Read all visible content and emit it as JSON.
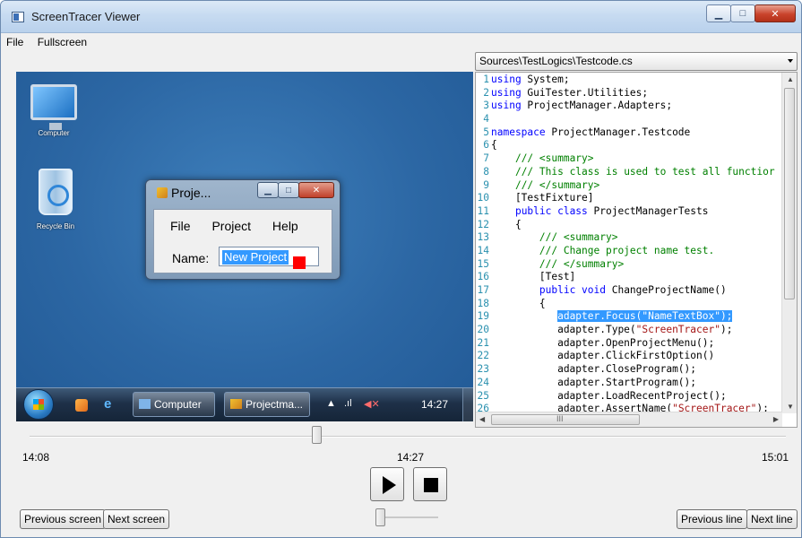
{
  "window": {
    "title": "ScreenTracer Viewer",
    "controls": {
      "minimize": "▁",
      "maximize": "□",
      "close": "✕"
    }
  },
  "menubar": {
    "items": [
      "File",
      "Fullscreen"
    ]
  },
  "capture": {
    "desktop_icons": [
      {
        "name": "computer-icon",
        "label": "Computer"
      },
      {
        "name": "recycle-bin-icon",
        "label": "Recycle Bin"
      }
    ],
    "app_window": {
      "title": "Proje...",
      "menu": [
        "File",
        "Project",
        "Help"
      ],
      "name_label": "Name:",
      "name_value": "New Project",
      "marker_color": "#ff0000"
    },
    "taskbar": {
      "buttons": [
        "Computer",
        "Projectma..."
      ],
      "clock": "14:27"
    }
  },
  "code_panel": {
    "file_path": "Sources\\TestLogics\\Testcode.cs",
    "highlight_line": 19,
    "lines": [
      {
        "n": "1",
        "parts": [
          [
            "kw",
            "using"
          ],
          [
            "",
            "System;"
          ]
        ]
      },
      {
        "n": "2",
        "parts": [
          [
            "kw",
            "using"
          ],
          [
            "",
            "GuiTester.Utilities;"
          ]
        ]
      },
      {
        "n": "3",
        "parts": [
          [
            "kw",
            "using"
          ],
          [
            "",
            "ProjectManager.Adapters;"
          ]
        ]
      },
      {
        "n": "4",
        "parts": []
      },
      {
        "n": "5",
        "parts": [
          [
            "kw",
            "namespace"
          ],
          [
            "",
            "ProjectManager.Testcode"
          ]
        ]
      },
      {
        "n": "6",
        "parts": [
          [
            "",
            "{"
          ]
        ]
      },
      {
        "n": "7",
        "parts": [
          [
            "",
            "    "
          ],
          [
            "cm",
            "/// <summary>"
          ]
        ]
      },
      {
        "n": "8",
        "parts": [
          [
            "",
            "    "
          ],
          [
            "cm",
            "/// This class is used to test all functior"
          ]
        ]
      },
      {
        "n": "9",
        "parts": [
          [
            "",
            "    "
          ],
          [
            "cm",
            "/// </summary>"
          ]
        ]
      },
      {
        "n": "10",
        "parts": [
          [
            "",
            "    [TestFixture]"
          ]
        ]
      },
      {
        "n": "11",
        "parts": [
          [
            "",
            "    "
          ],
          [
            "kw",
            "public class"
          ],
          [
            "",
            "ProjectManagerTests"
          ]
        ]
      },
      {
        "n": "12",
        "parts": [
          [
            "",
            "    {"
          ]
        ]
      },
      {
        "n": "13",
        "parts": [
          [
            "",
            "        "
          ],
          [
            "cm",
            "/// <summary>"
          ]
        ]
      },
      {
        "n": "14",
        "parts": [
          [
            "",
            "        "
          ],
          [
            "cm",
            "/// Change project name test."
          ]
        ]
      },
      {
        "n": "15",
        "parts": [
          [
            "",
            "        "
          ],
          [
            "cm",
            "/// </summary>"
          ]
        ]
      },
      {
        "n": "16",
        "parts": [
          [
            "",
            "        [Test]"
          ]
        ]
      },
      {
        "n": "17",
        "parts": [
          [
            "",
            "        "
          ],
          [
            "kw",
            "public void"
          ],
          [
            "",
            "ChangeProjectName()"
          ]
        ]
      },
      {
        "n": "18",
        "parts": [
          [
            "",
            "        {"
          ]
        ]
      },
      {
        "n": "19",
        "parts": [
          [
            "",
            "           "
          ],
          [
            "hl",
            "adapter.Focus(\"NameTextBox\");"
          ]
        ]
      },
      {
        "n": "20",
        "parts": [
          [
            "",
            "           adapter.Type("
          ],
          [
            "st",
            "\"ScreenTracer\""
          ],
          [
            "",
            ");"
          ]
        ]
      },
      {
        "n": "21",
        "parts": [
          [
            "",
            "           adapter.OpenProjectMenu();"
          ]
        ]
      },
      {
        "n": "22",
        "parts": [
          [
            "",
            "           adapter.ClickFirstOption()"
          ]
        ]
      },
      {
        "n": "23",
        "parts": [
          [
            "",
            "           adapter.CloseProgram();"
          ]
        ]
      },
      {
        "n": "24",
        "parts": [
          [
            "",
            "           adapter.StartProgram();"
          ]
        ]
      },
      {
        "n": "25",
        "parts": [
          [
            "",
            "           adapter.LoadRecentProject();"
          ]
        ]
      },
      {
        "n": "26",
        "parts": [
          [
            "",
            "           adapter.AssertName("
          ],
          [
            "st",
            "\"ScreenTracer\""
          ],
          [
            "",
            ");"
          ]
        ]
      }
    ],
    "hscroll_label": "III"
  },
  "playback": {
    "start_time": "14:08",
    "current_time": "14:27",
    "end_time": "15:01",
    "progress_fraction": 0.38,
    "speed_fraction": 0.0
  },
  "buttons": {
    "previous_screen": "Previous screen",
    "next_screen": "Next screen",
    "previous_line": "Previous line",
    "next_line": "Next line"
  }
}
